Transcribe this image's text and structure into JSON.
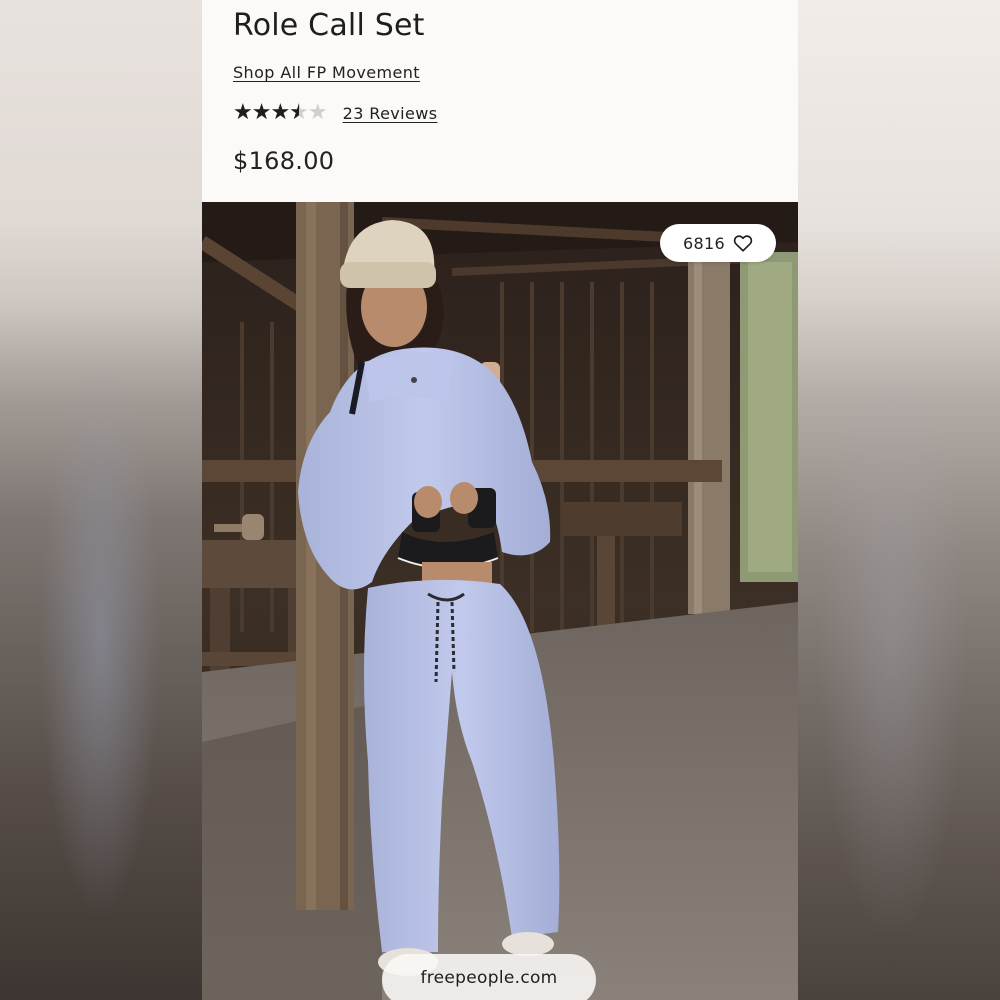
{
  "product": {
    "title": "Role Call Set",
    "collection_link": "Shop All FP Movement",
    "rating": 3.5,
    "rating_max": 5,
    "stars_display": "★★★★★",
    "reviews_label": "23 Reviews",
    "price": "$168.00"
  },
  "image": {
    "favorite_count": "6816",
    "favorite_icon": "heart-outline-icon",
    "source_domain": "freepeople.com"
  },
  "colors": {
    "text": "#1e1e1e",
    "star_filled": "#1e1e1e",
    "star_empty": "#cfcfcf",
    "card_background": "#fbfaf8",
    "garment": "#b8c2e6"
  }
}
